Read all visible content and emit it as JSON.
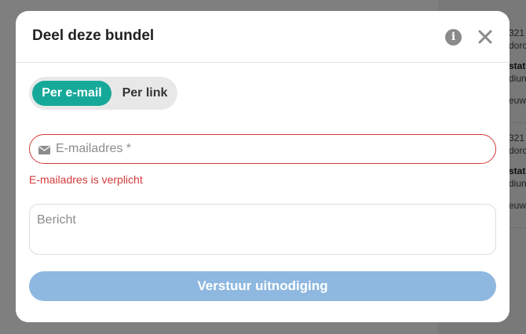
{
  "modal": {
    "title": "Deel deze bundel",
    "info_icon_glyph": "i",
    "tabs": [
      {
        "label": "Per e-mail",
        "active": true
      },
      {
        "label": "Per link",
        "active": false
      }
    ],
    "email_field": {
      "placeholder": "E-mailadres *",
      "value": "",
      "error": "E-mailadres is verplicht"
    },
    "message_field": {
      "placeholder": "Bericht",
      "value": ""
    },
    "submit_label": "Verstuur uitnodiging",
    "icons": [
      "info-icon",
      "close-icon",
      "envelope-icon"
    ]
  },
  "background": {
    "cards": [
      {
        "lines": [
          "321",
          "dorc",
          "stat",
          "diun",
          "euw"
        ]
      },
      {
        "lines": [
          "321",
          "dorc",
          "stat",
          "diun",
          "euw"
        ]
      }
    ]
  },
  "colors": {
    "accent": "#16a99a",
    "error": "#d23b3b",
    "submit_disabled": "#8fb8e0"
  }
}
